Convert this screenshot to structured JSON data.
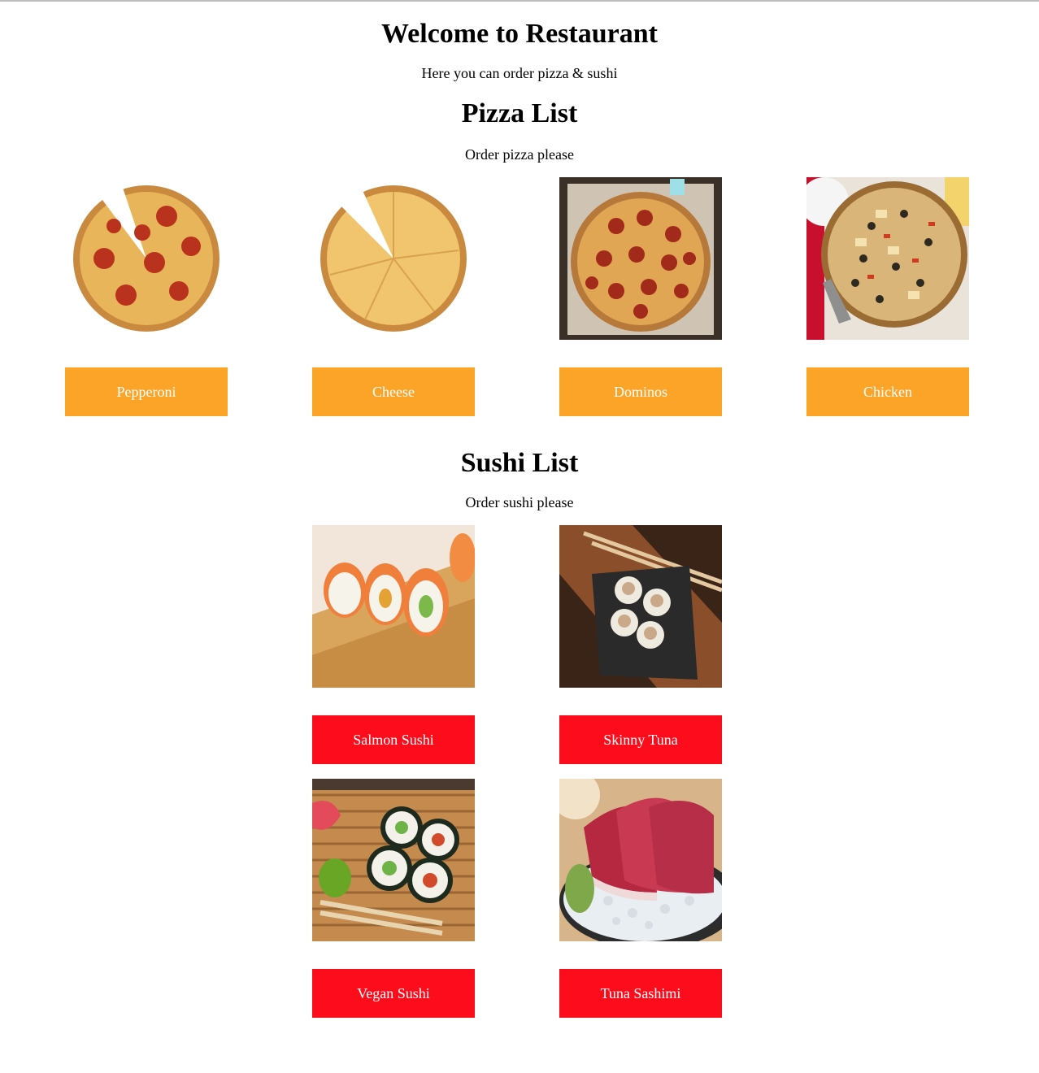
{
  "header": {
    "title": "Welcome to Restaurant",
    "subtitle": "Here you can order pizza & sushi"
  },
  "pizza": {
    "heading": "Pizza List",
    "subheading": "Order pizza please",
    "items": [
      {
        "label": "Pepperoni",
        "image": "pepperoni-pizza-image"
      },
      {
        "label": "Cheese",
        "image": "cheese-pizza-image"
      },
      {
        "label": "Dominos",
        "image": "dominos-pizza-image"
      },
      {
        "label": "Chicken",
        "image": "chicken-pizza-image"
      }
    ],
    "button_color": "#fba428"
  },
  "sushi": {
    "heading": "Sushi List",
    "subheading": "Order sushi please",
    "items": [
      {
        "label": "Salmon Sushi",
        "image": "salmon-sushi-image"
      },
      {
        "label": "Skinny Tuna",
        "image": "skinny-tuna-image"
      },
      {
        "label": "Vegan Sushi",
        "image": "vegan-sushi-image"
      },
      {
        "label": "Tuna Sashimi",
        "image": "tuna-sashimi-image"
      }
    ],
    "button_color": "#fd0d1b"
  }
}
